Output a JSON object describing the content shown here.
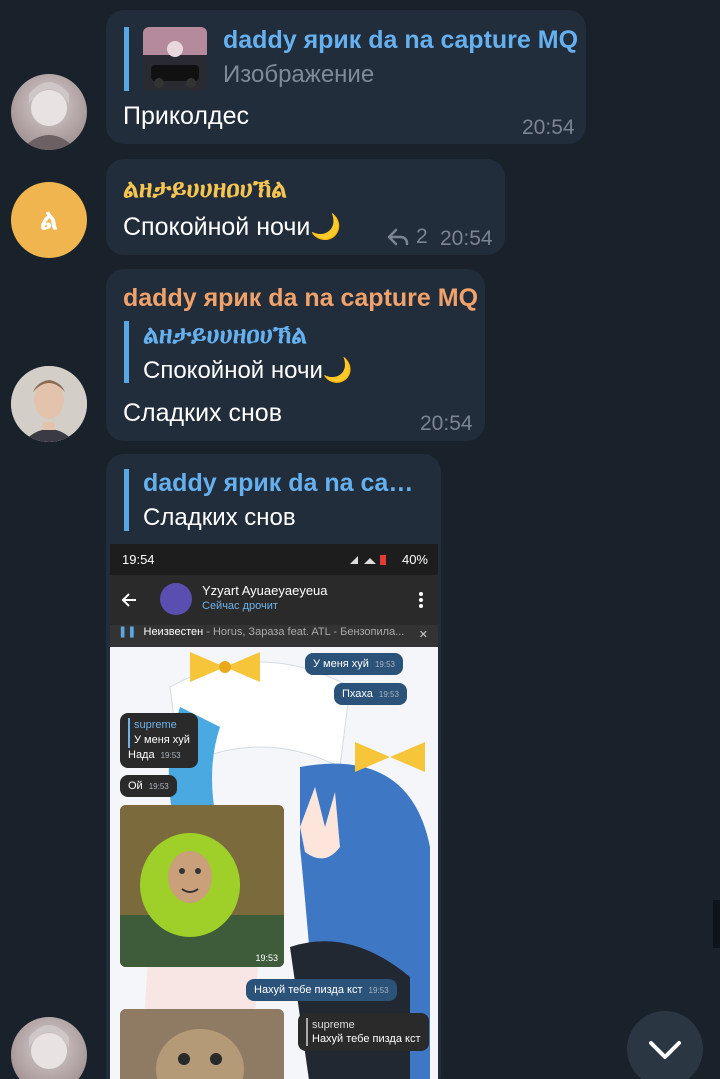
{
  "messages": [
    {
      "reply_author": "daddy ярик da na capture MQ",
      "reply_sub": "Изображение",
      "text": "Приколдес",
      "time": "20:54"
    },
    {
      "author": "ልዘታይሀሀዘዐሀኽል",
      "text": "Спокойной ночи🌙",
      "reply_count": "2",
      "time": "20:54",
      "avatar_letter": "ል"
    },
    {
      "author": "daddy ярик da na capture MQ",
      "reply_author": "ልዘታይሀሀዘዐሀኽል",
      "reply_text": "Спокойной ночи🌙",
      "text": "Сладких снов",
      "time": "20:54"
    },
    {
      "reply_author": "daddy ярик da na capt…",
      "reply_text": "Сладких снов"
    }
  ],
  "screenshot": {
    "status_time": "19:54",
    "battery": "40%",
    "chat_name": "Yzyart Ayuaeyaeyeua",
    "chat_status": "Сейчас дрочит",
    "player_title": "Неизвестен",
    "player_track": " - Horus, Зараза feat. ATL - Бензопила...",
    "bubbles": [
      {
        "text": "У меня хуй",
        "time": "19:53"
      },
      {
        "text": "Пхаха",
        "time": "19:53"
      },
      {
        "reply_author": "supreme",
        "reply_text": "У меня хуй",
        "text": "Нада",
        "time": "19:53"
      },
      {
        "text": "Ой",
        "time": "19:53"
      },
      {
        "time": "19:53"
      },
      {
        "text": "Нахуй тебе пизда кст",
        "time": "19:53"
      },
      {
        "reply_author": "supreme",
        "reply_text": "Нахуй тебе пизда кст"
      }
    ]
  },
  "colors": {
    "background": "#19212b",
    "bubble": "#222d3b",
    "link": "#65b0ee",
    "author1": "#f0a26a",
    "author2": "#f5c451",
    "avatar_yellow": "#f0b54e"
  },
  "icons": {
    "reply": "reply-arrow-icon",
    "scroll_down": "chevron-down-icon"
  }
}
